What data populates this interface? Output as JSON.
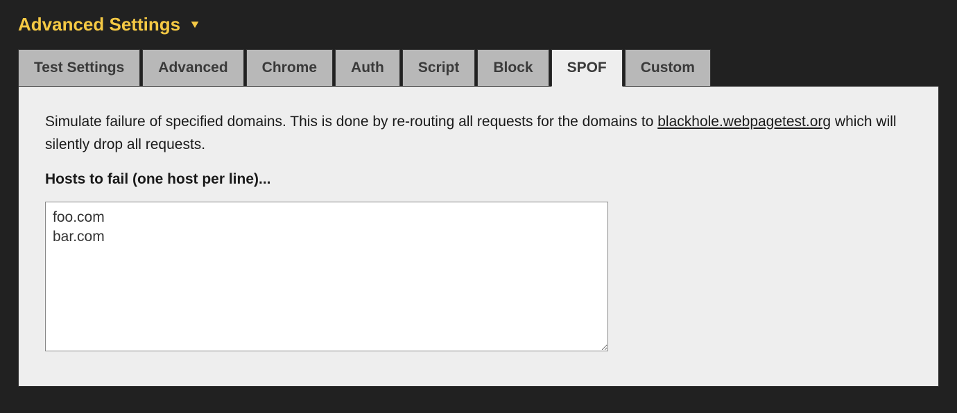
{
  "header": {
    "title": "Advanced Settings"
  },
  "tabs": [
    {
      "label": "Test Settings"
    },
    {
      "label": "Advanced"
    },
    {
      "label": "Chrome"
    },
    {
      "label": "Auth"
    },
    {
      "label": "Script"
    },
    {
      "label": "Block"
    },
    {
      "label": "SPOF"
    },
    {
      "label": "Custom"
    }
  ],
  "active_tab_index": 6,
  "panel": {
    "description_pre": "Simulate failure of specified domains. This is done by re-routing all requests for the domains to ",
    "description_link": "blackhole.webpagetest.org",
    "description_post": " which will silently drop all requests.",
    "hosts_label": "Hosts to fail (one host per line)...",
    "hosts_value": "foo.com\nbar.com"
  }
}
